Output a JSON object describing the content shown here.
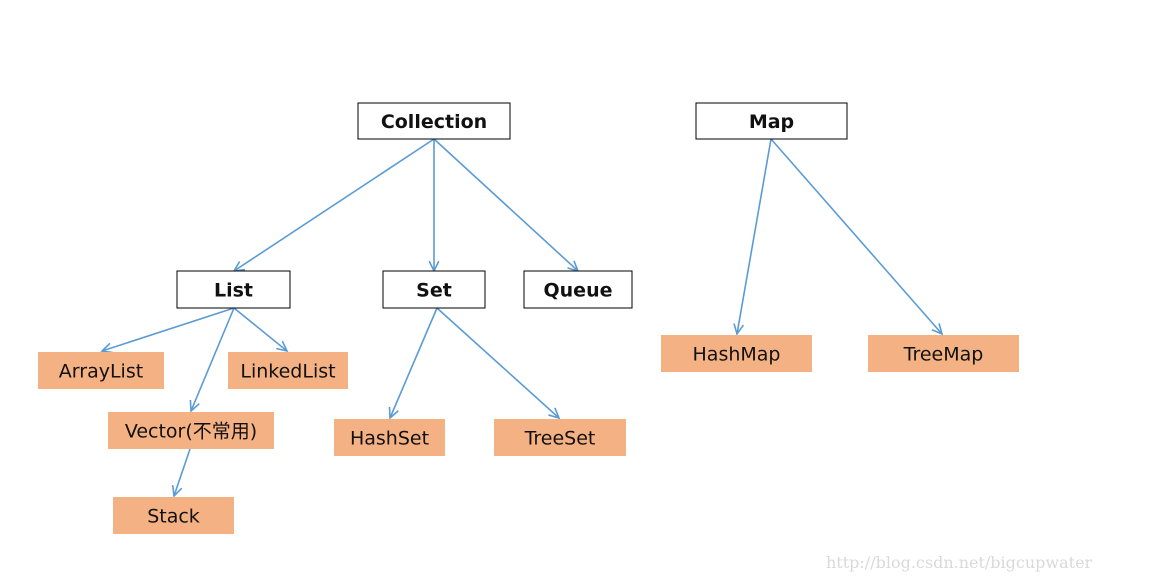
{
  "colors": {
    "edge": "#5B9BD5",
    "abstract_fill": "#FFFFFF",
    "abstract_stroke": "#000000",
    "concrete_fill": "#F4B183"
  },
  "nodes": [
    {
      "id": "collection",
      "label": "Collection",
      "kind": "interface"
    },
    {
      "id": "map",
      "label": "Map",
      "kind": "interface"
    },
    {
      "id": "list",
      "label": "List",
      "kind": "interface"
    },
    {
      "id": "set",
      "label": "Set",
      "kind": "interface"
    },
    {
      "id": "queue",
      "label": "Queue",
      "kind": "interface"
    },
    {
      "id": "arraylist",
      "label": "ArrayList",
      "kind": "class"
    },
    {
      "id": "linkedlist",
      "label": "LinkedList",
      "kind": "class"
    },
    {
      "id": "vector",
      "label": "Vector(不常用)",
      "kind": "class"
    },
    {
      "id": "stack",
      "label": "Stack",
      "kind": "class"
    },
    {
      "id": "hashset",
      "label": "HashSet",
      "kind": "class"
    },
    {
      "id": "treeset",
      "label": "TreeSet",
      "kind": "class"
    },
    {
      "id": "hashmap",
      "label": "HashMap",
      "kind": "class"
    },
    {
      "id": "treemap",
      "label": "TreeMap",
      "kind": "class"
    }
  ],
  "edges": [
    {
      "from": "collection",
      "to": "list"
    },
    {
      "from": "collection",
      "to": "set"
    },
    {
      "from": "collection",
      "to": "queue"
    },
    {
      "from": "list",
      "to": "arraylist"
    },
    {
      "from": "list",
      "to": "vector"
    },
    {
      "from": "list",
      "to": "linkedlist"
    },
    {
      "from": "vector",
      "to": "stack"
    },
    {
      "from": "set",
      "to": "hashset"
    },
    {
      "from": "set",
      "to": "treeset"
    },
    {
      "from": "map",
      "to": "hashmap"
    },
    {
      "from": "map",
      "to": "treemap"
    }
  ],
  "watermark": "http://blog.csdn.net/bigcupwater"
}
